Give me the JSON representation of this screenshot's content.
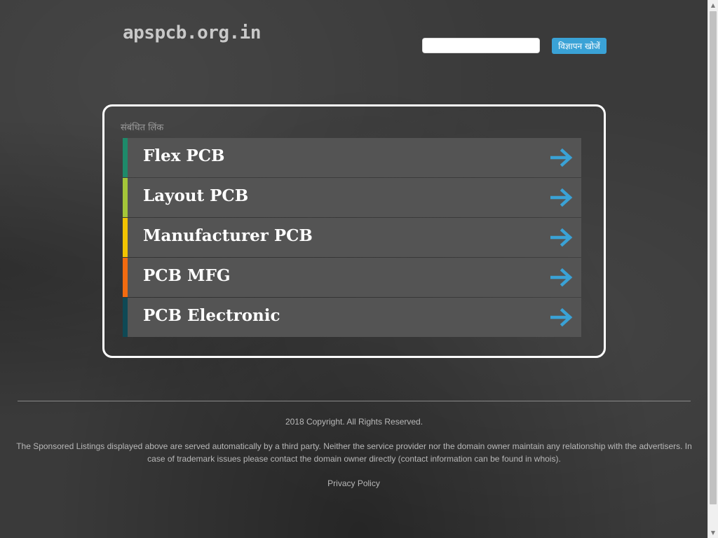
{
  "header": {
    "site_title": "apspcb.org.in",
    "search_placeholder": "",
    "search_button_label": "विज्ञापन खोजें"
  },
  "related_links": {
    "heading": "संबंधित लिंक",
    "items": [
      {
        "label": "Flex PCB",
        "stripe_color": "#1e8a6a"
      },
      {
        "label": "Layout PCB",
        "stripe_color": "#a4c639"
      },
      {
        "label": "Manufacturer PCB",
        "stripe_color": "#f2c400"
      },
      {
        "label": "PCB MFG",
        "stripe_color": "#f26b10"
      },
      {
        "label": "PCB Electronic",
        "stripe_color": "#0f4955"
      }
    ],
    "arrow_icon": "right-arrow-icon",
    "arrow_color": "#3aa2d6"
  },
  "footer": {
    "copyright": "2018 Copyright. All Rights Reserved.",
    "disclaimer": "The Sponsored Listings displayed above are served automatically by a third party. Neither the service provider nor the domain owner maintain any relationship with the advertisers. In case of trademark issues please contact the domain owner directly (contact information can be found in whois).",
    "privacy_policy": "Privacy Policy"
  },
  "colors": {
    "background": "#3a3a3a",
    "panel_border": "#ffffff",
    "link_background": "#545454",
    "button": "#3aa2d6"
  }
}
